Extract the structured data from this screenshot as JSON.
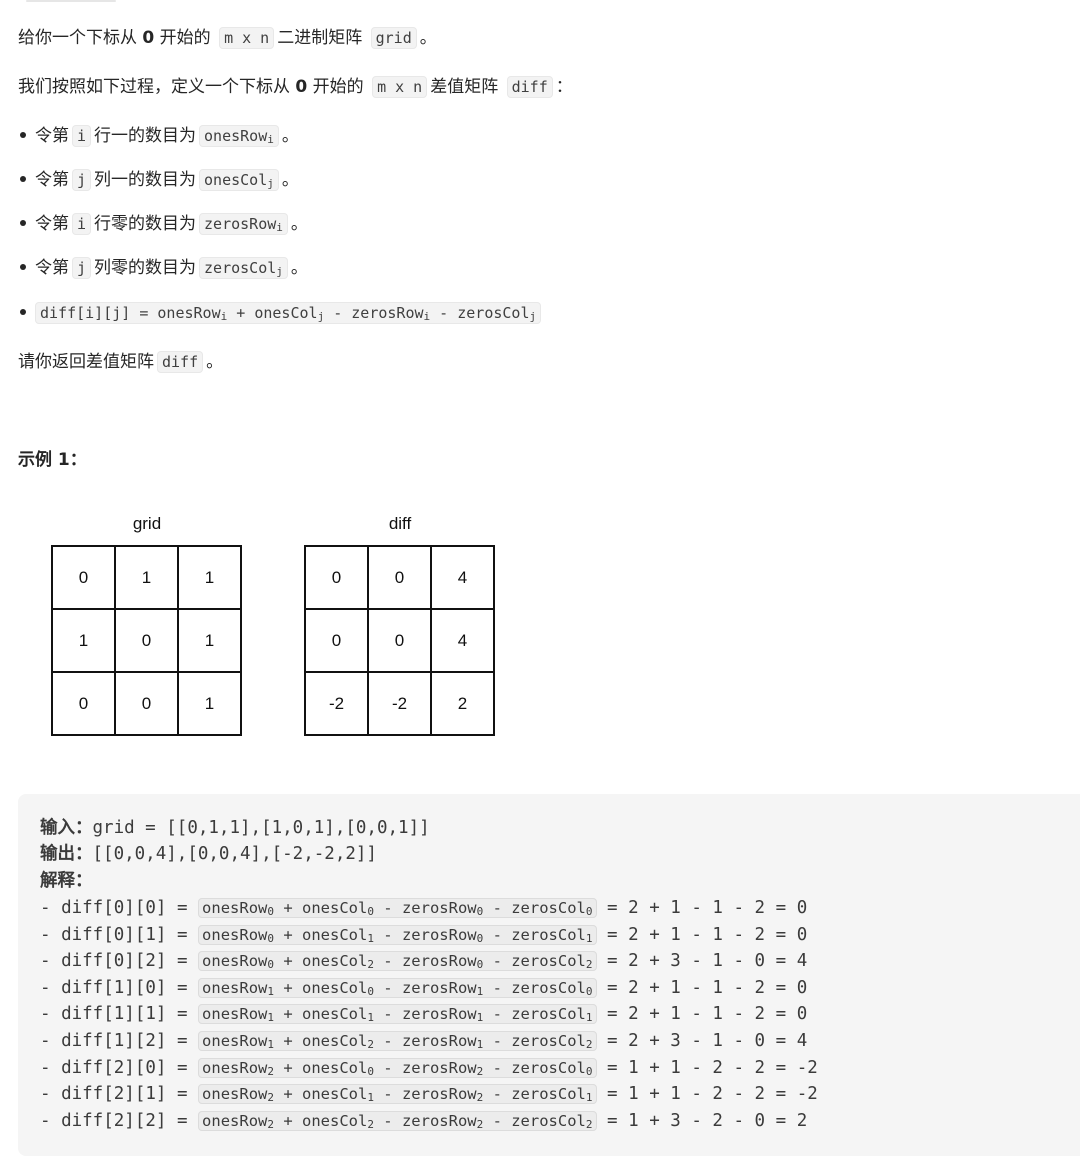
{
  "intro": {
    "p1_a": "给你一个下标从",
    "p1_zero": "0",
    "p1_b": "开始的",
    "p1_code1": "m x n",
    "p1_c": "二进制矩阵",
    "p1_code2": "grid",
    "p1_d": "。",
    "p2_a": "我们按照如下过程，定义一个下标从",
    "p2_zero": "0",
    "p2_b": "开始的",
    "p2_code1": "m x n",
    "p2_c": "差值矩阵",
    "p2_code2": "diff",
    "p2_d": "："
  },
  "bullets": [
    {
      "pre": "令第",
      "var": "i",
      "mid": "行一的数目为",
      "code": "onesRow",
      "sub": "i",
      "post": "。"
    },
    {
      "pre": "令第",
      "var": "j",
      "mid": "列一的数目为",
      "code": "onesCol",
      "sub": "j",
      "post": "。"
    },
    {
      "pre": "令第",
      "var": "i",
      "mid": "行零的数目为",
      "code": "zerosRow",
      "sub": "i",
      "post": "。"
    },
    {
      "pre": "令第",
      "var": "j",
      "mid": "列零的数目为",
      "code": "zerosCol",
      "sub": "j",
      "post": "。"
    }
  ],
  "formula": {
    "head": "diff[i][j] = onesRow",
    "s1": "i",
    "t1": " + onesCol",
    "s2": "j",
    "t2": " - zerosRow",
    "s3": "i",
    "t3": " - zerosCol",
    "s4": "j"
  },
  "return_line": {
    "a": "请你返回差值矩阵",
    "code": "diff",
    "b": "。"
  },
  "example_heading": "示例 1：",
  "figure": {
    "grid_label": "grid",
    "diff_label": "diff",
    "grid": [
      [
        "0",
        "1",
        "1"
      ],
      [
        "1",
        "0",
        "1"
      ],
      [
        "0",
        "0",
        "1"
      ]
    ],
    "diff": [
      [
        "0",
        "0",
        "4"
      ],
      [
        "0",
        "0",
        "4"
      ],
      [
        "-2",
        "-2",
        "2"
      ]
    ]
  },
  "example": {
    "input_key": "输入：",
    "input_val": "grid = [[0,1,1],[1,0,1],[0,0,1]]",
    "output_key": "输出：",
    "output_val": "[[0,0,4],[0,0,4],[-2,-2,2]]",
    "explain_key": "解释：",
    "rows": [
      {
        "lhs": "- diff[0][0] = ",
        "r": "0",
        "c": "0",
        "rhs": " = 2 + 1 - 1 - 2 = 0"
      },
      {
        "lhs": "- diff[0][1] = ",
        "r": "0",
        "c": "1",
        "rhs": " = 2 + 1 - 1 - 2 = 0"
      },
      {
        "lhs": "- diff[0][2] = ",
        "r": "0",
        "c": "2",
        "rhs": " = 2 + 3 - 1 - 0 = 4"
      },
      {
        "lhs": "- diff[1][0] = ",
        "r": "1",
        "c": "0",
        "rhs": " = 2 + 1 - 1 - 2 = 0"
      },
      {
        "lhs": "- diff[1][1] = ",
        "r": "1",
        "c": "1",
        "rhs": " = 2 + 1 - 1 - 2 = 0"
      },
      {
        "lhs": "- diff[1][2] = ",
        "r": "1",
        "c": "2",
        "rhs": " = 2 + 3 - 1 - 0 = 4"
      },
      {
        "lhs": "- diff[2][0] = ",
        "r": "2",
        "c": "0",
        "rhs": " = 1 + 1 - 2 - 2 = -2"
      },
      {
        "lhs": "- diff[2][1] = ",
        "r": "2",
        "c": "1",
        "rhs": " = 1 + 1 - 2 - 2 = -2"
      },
      {
        "lhs": "- diff[2][2] = ",
        "r": "2",
        "c": "2",
        "rhs": " = 1 + 3 - 2 - 0 = 2"
      }
    ]
  }
}
